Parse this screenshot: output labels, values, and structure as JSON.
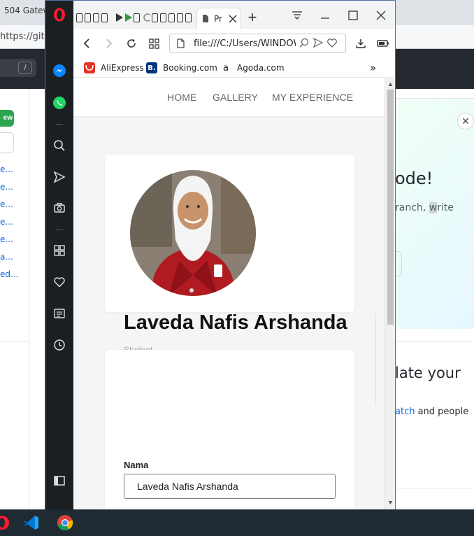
{
  "background_window": {
    "tab_title": "504 Gatew",
    "url_fragment": "https://githu",
    "shortcut_key": "/",
    "new_button_label": "ew",
    "repo_links": [
      "e...",
      "e...",
      "e...",
      "e...",
      "e...",
      "a...",
      "ed..."
    ],
    "promo_title": "ode!",
    "promo_subtitle_prefix": "ranch, ",
    "promo_subtitle_highlight": "w",
    "promo_subtitle_suffix": "rite",
    "close_label": "✕",
    "section_title": "late your",
    "section_sub_link": "atch",
    "section_sub_rest": " and people"
  },
  "browser": {
    "active_tab_title": "Pr",
    "address": "file:///C:/Users/WINDOW",
    "bookmarks": [
      {
        "label": "AliExpress",
        "color": "#e43225",
        "glyph": "🛍"
      },
      {
        "label": "Booking.com",
        "color": "#003580",
        "glyph": "B."
      },
      {
        "label": "Agoda.com",
        "color": "#ffffff",
        "glyph": "a"
      }
    ],
    "more_bookmarks": "»"
  },
  "site": {
    "nav": [
      "HOME",
      "GALLERY",
      "MY EXPERIENCE"
    ],
    "profile": {
      "name": "Laveda Nafis Arshanda",
      "role": "Student"
    },
    "form": {
      "name_label": "Nama",
      "name_value": "Laveda Nafis Arshanda"
    }
  },
  "theme": {
    "sidebar_bg": "#1c1f22",
    "opera_red": "#ff1b2d",
    "messenger_blue": "#0a84ff",
    "whatsapp_green": "#25d366",
    "nav_text": "#666666"
  }
}
